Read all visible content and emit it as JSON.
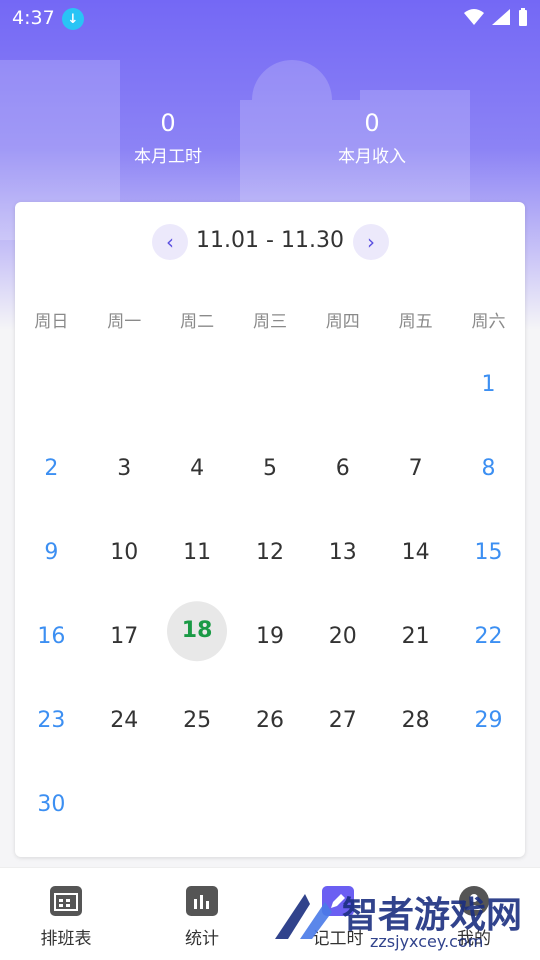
{
  "status_bar": {
    "time": "4:37"
  },
  "summary": {
    "hours_value": "0",
    "hours_label": "本月工时",
    "income_value": "0",
    "income_label": "本月收入"
  },
  "calendar": {
    "range": "11.01 - 11.30",
    "weekdays": [
      "周日",
      "周一",
      "周二",
      "周三",
      "周四",
      "周五",
      "周六"
    ],
    "weeks": [
      [
        "",
        "",
        "",
        "",
        "",
        "",
        "1"
      ],
      [
        "2",
        "3",
        "4",
        "5",
        "6",
        "7",
        "8"
      ],
      [
        "9",
        "10",
        "11",
        "12",
        "13",
        "14",
        "15"
      ],
      [
        "16",
        "17",
        "18",
        "19",
        "20",
        "21",
        "22"
      ],
      [
        "23",
        "24",
        "25",
        "26",
        "27",
        "28",
        "29"
      ],
      [
        "30",
        "",
        "",
        "",
        "",
        "",
        ""
      ]
    ],
    "today": "18"
  },
  "tabs": [
    {
      "label": "排班表",
      "icon": "calendar-icon"
    },
    {
      "label": "统计",
      "icon": "bar-chart-icon"
    },
    {
      "label": "记工时",
      "icon": "edit-icon"
    },
    {
      "label": "我的",
      "icon": "user-icon"
    }
  ],
  "watermark": {
    "text": "智者游戏网",
    "url": "zzsjyxcey.com"
  },
  "colors": {
    "accent": "#6b5ff2",
    "weekend": "#3c8ff2",
    "today": "#1a9a45"
  }
}
